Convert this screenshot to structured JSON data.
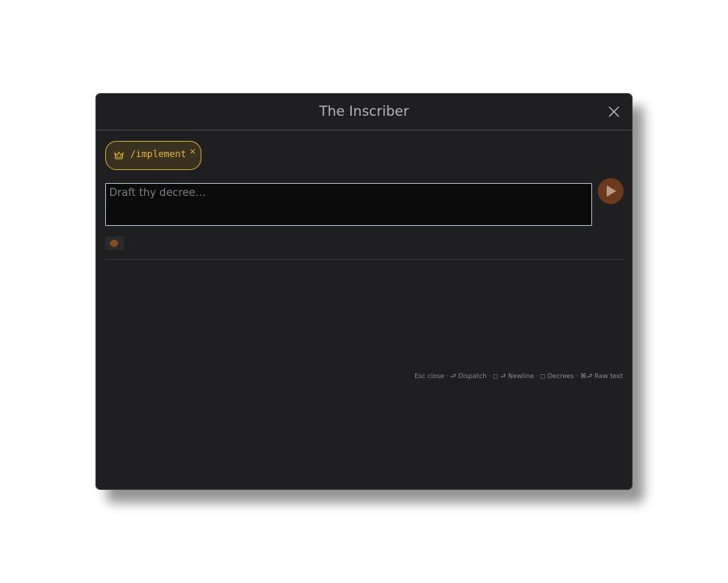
{
  "dialog": {
    "title": "The Inscriber",
    "close_icon": "close-icon"
  },
  "chip": {
    "icon": "crown-icon",
    "icon_color": "#e6b33d",
    "label": "/implement",
    "remove_label": "×"
  },
  "editor": {
    "value": "",
    "placeholder": "Draft thy decree…"
  },
  "send": {
    "icon": "play-triangle-icon",
    "color": "#6b3a1e"
  },
  "attach": {
    "icon": "attach-icon"
  },
  "hints": {
    "text": "Esc close · ⮐ Dispatch · ◻ ⮐ Newline · ◻ Decrees · ⌘⮐ Raw text"
  },
  "colors": {
    "background": "#1f1f21",
    "accent": "#e6b33d",
    "editor_border": "#a9b8c8"
  }
}
